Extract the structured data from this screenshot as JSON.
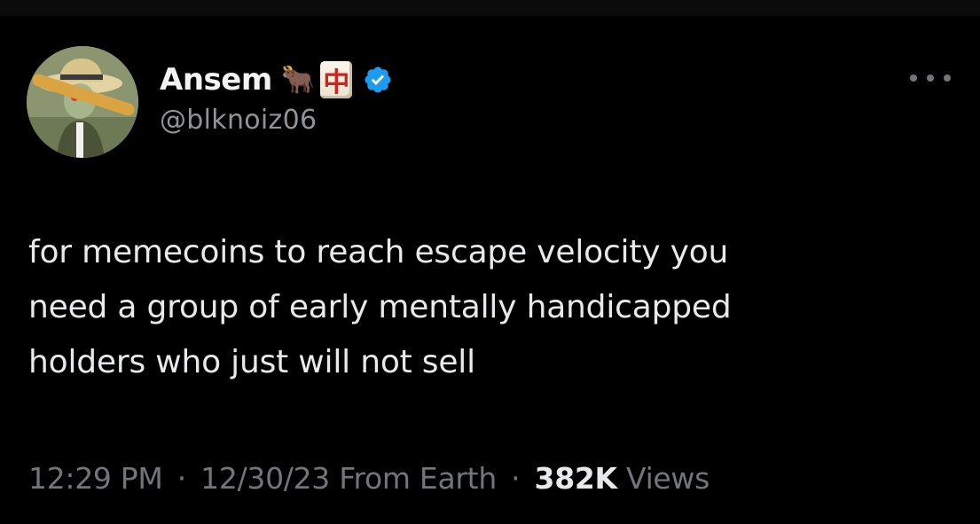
{
  "author": {
    "display_name": "Ansem",
    "emoji_ox": "🐂",
    "emoji_mahjong": "中",
    "handle": "@blknoiz06",
    "verified": true
  },
  "icons": {
    "verified": "verified-badge-icon",
    "more": "more-options-icon"
  },
  "tweet": {
    "lines": [
      "for memecoins to reach escape velocity you",
      "need a group of early mentally handicapped",
      "holders who just will not sell"
    ]
  },
  "meta": {
    "time": "12:29 PM",
    "separator": "·",
    "date": "12/30/23",
    "location": "From Earth",
    "views_count": "382K",
    "views_label": "Views"
  },
  "colors": {
    "background": "#000000",
    "text": "#e7e9ea",
    "secondary": "#71767b",
    "verified_blue": "#1d9bf0"
  }
}
